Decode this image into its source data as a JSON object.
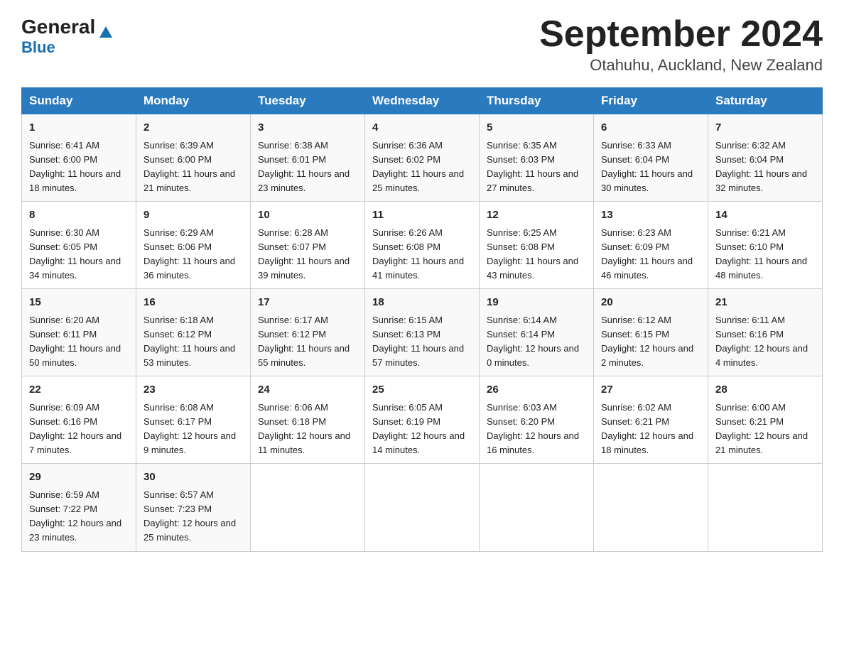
{
  "header": {
    "logo_line1": "General",
    "logo_line2": "Blue",
    "main_title": "September 2024",
    "subtitle": "Otahuhu, Auckland, New Zealand"
  },
  "days_header": [
    "Sunday",
    "Monday",
    "Tuesday",
    "Wednesday",
    "Thursday",
    "Friday",
    "Saturday"
  ],
  "weeks": [
    [
      {
        "day": "1",
        "sunrise": "6:41 AM",
        "sunset": "6:00 PM",
        "daylight": "11 hours and 18 minutes."
      },
      {
        "day": "2",
        "sunrise": "6:39 AM",
        "sunset": "6:00 PM",
        "daylight": "11 hours and 21 minutes."
      },
      {
        "day": "3",
        "sunrise": "6:38 AM",
        "sunset": "6:01 PM",
        "daylight": "11 hours and 23 minutes."
      },
      {
        "day": "4",
        "sunrise": "6:36 AM",
        "sunset": "6:02 PM",
        "daylight": "11 hours and 25 minutes."
      },
      {
        "day": "5",
        "sunrise": "6:35 AM",
        "sunset": "6:03 PM",
        "daylight": "11 hours and 27 minutes."
      },
      {
        "day": "6",
        "sunrise": "6:33 AM",
        "sunset": "6:04 PM",
        "daylight": "11 hours and 30 minutes."
      },
      {
        "day": "7",
        "sunrise": "6:32 AM",
        "sunset": "6:04 PM",
        "daylight": "11 hours and 32 minutes."
      }
    ],
    [
      {
        "day": "8",
        "sunrise": "6:30 AM",
        "sunset": "6:05 PM",
        "daylight": "11 hours and 34 minutes."
      },
      {
        "day": "9",
        "sunrise": "6:29 AM",
        "sunset": "6:06 PM",
        "daylight": "11 hours and 36 minutes."
      },
      {
        "day": "10",
        "sunrise": "6:28 AM",
        "sunset": "6:07 PM",
        "daylight": "11 hours and 39 minutes."
      },
      {
        "day": "11",
        "sunrise": "6:26 AM",
        "sunset": "6:08 PM",
        "daylight": "11 hours and 41 minutes."
      },
      {
        "day": "12",
        "sunrise": "6:25 AM",
        "sunset": "6:08 PM",
        "daylight": "11 hours and 43 minutes."
      },
      {
        "day": "13",
        "sunrise": "6:23 AM",
        "sunset": "6:09 PM",
        "daylight": "11 hours and 46 minutes."
      },
      {
        "day": "14",
        "sunrise": "6:21 AM",
        "sunset": "6:10 PM",
        "daylight": "11 hours and 48 minutes."
      }
    ],
    [
      {
        "day": "15",
        "sunrise": "6:20 AM",
        "sunset": "6:11 PM",
        "daylight": "11 hours and 50 minutes."
      },
      {
        "day": "16",
        "sunrise": "6:18 AM",
        "sunset": "6:12 PM",
        "daylight": "11 hours and 53 minutes."
      },
      {
        "day": "17",
        "sunrise": "6:17 AM",
        "sunset": "6:12 PM",
        "daylight": "11 hours and 55 minutes."
      },
      {
        "day": "18",
        "sunrise": "6:15 AM",
        "sunset": "6:13 PM",
        "daylight": "11 hours and 57 minutes."
      },
      {
        "day": "19",
        "sunrise": "6:14 AM",
        "sunset": "6:14 PM",
        "daylight": "12 hours and 0 minutes."
      },
      {
        "day": "20",
        "sunrise": "6:12 AM",
        "sunset": "6:15 PM",
        "daylight": "12 hours and 2 minutes."
      },
      {
        "day": "21",
        "sunrise": "6:11 AM",
        "sunset": "6:16 PM",
        "daylight": "12 hours and 4 minutes."
      }
    ],
    [
      {
        "day": "22",
        "sunrise": "6:09 AM",
        "sunset": "6:16 PM",
        "daylight": "12 hours and 7 minutes."
      },
      {
        "day": "23",
        "sunrise": "6:08 AM",
        "sunset": "6:17 PM",
        "daylight": "12 hours and 9 minutes."
      },
      {
        "day": "24",
        "sunrise": "6:06 AM",
        "sunset": "6:18 PM",
        "daylight": "12 hours and 11 minutes."
      },
      {
        "day": "25",
        "sunrise": "6:05 AM",
        "sunset": "6:19 PM",
        "daylight": "12 hours and 14 minutes."
      },
      {
        "day": "26",
        "sunrise": "6:03 AM",
        "sunset": "6:20 PM",
        "daylight": "12 hours and 16 minutes."
      },
      {
        "day": "27",
        "sunrise": "6:02 AM",
        "sunset": "6:21 PM",
        "daylight": "12 hours and 18 minutes."
      },
      {
        "day": "28",
        "sunrise": "6:00 AM",
        "sunset": "6:21 PM",
        "daylight": "12 hours and 21 minutes."
      }
    ],
    [
      {
        "day": "29",
        "sunrise": "6:59 AM",
        "sunset": "7:22 PM",
        "daylight": "12 hours and 23 minutes."
      },
      {
        "day": "30",
        "sunrise": "6:57 AM",
        "sunset": "7:23 PM",
        "daylight": "12 hours and 25 minutes."
      },
      null,
      null,
      null,
      null,
      null
    ]
  ],
  "labels": {
    "sunrise": "Sunrise:",
    "sunset": "Sunset:",
    "daylight": "Daylight:"
  }
}
